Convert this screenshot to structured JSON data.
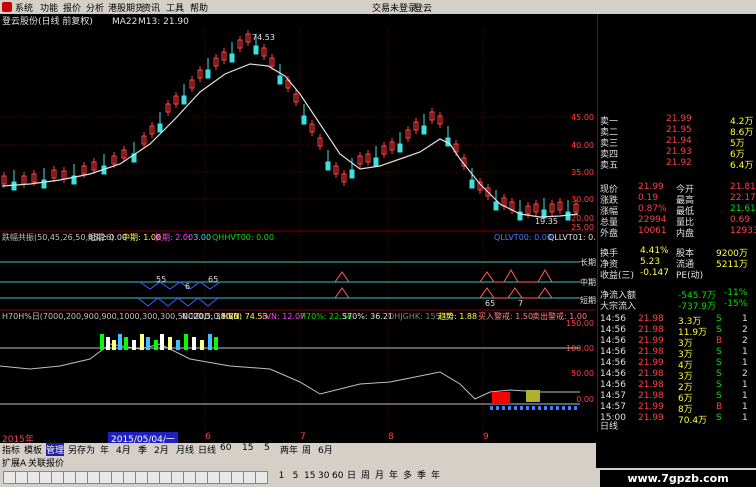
{
  "menu": {
    "items": [
      "系统",
      "功能",
      "报价",
      "分析",
      "港股期货",
      "资讯",
      "工具",
      "帮助"
    ],
    "right": [
      "交易未登录",
      "登云"
    ]
  },
  "chart_header": {
    "stock": "登云股份(日线 前复权)",
    "ma_label": "MA22",
    "m13": "M13: 21.90"
  },
  "price_axis": [
    "45.00",
    "40.00",
    "35.00",
    "30.00",
    "25.00",
    "20.00"
  ],
  "annotations": {
    "high": "74.53",
    "low": "19.35"
  },
  "indicator1": {
    "formula": "跌幅共振(50,45,26,50,45,26)",
    "short_label": "短期: 0.00",
    "mid_label": "中期: 1.00",
    "long_label": "长期: 2.00",
    "three": ": 3.00",
    "qhh": "QHHVT00: 0.00",
    "qll": "QLLVT00: 0.00",
    "qll2": "QLLVT01: 0.00",
    "lines": [
      "长期",
      "中期",
      "短期"
    ],
    "marks": [
      "55",
      "6",
      "65",
      "65",
      "7"
    ]
  },
  "indicator2": {
    "formula": "H70H%日(7000,200,900,900,1000,300,300,50000,5,0,50,0)",
    "ncz": "NCZ0D: 38.80",
    "hvn": "HVN: 74.53",
    "lvn": "LVN: 12.07",
    "h70": "H70%: 22.36",
    "s70": "S70%: 36.21",
    "ohj": "OHJGHK: 155.00",
    "trend": "趋势: 1.88",
    "buy": "买入警戒: 1.50",
    "sell": "卖出警戒: 1.00",
    "axis": [
      "150.00",
      "100.00",
      "50.00",
      "0.00"
    ]
  },
  "date_axis": {
    "year": "2015年",
    "cursor": "2015/05/04/一",
    "months": [
      "6",
      "7",
      "8",
      "9"
    ]
  },
  "tabs1": [
    "指标",
    "模板",
    "管理",
    "另存为",
    "年",
    "4月",
    "季",
    "2月",
    "月线",
    "日线",
    "60",
    "15",
    "5",
    "两年",
    "周",
    "6月"
  ],
  "tabs2": [
    "扩展A",
    "关联报价"
  ],
  "toolbar_periods": [
    "1",
    "5",
    "15",
    "30",
    "60",
    "日",
    "周",
    "月",
    "年",
    "多",
    "季",
    "年"
  ],
  "watermark": "www.7gpzb.com",
  "panel": {
    "sell": [
      {
        "label": "卖一",
        "price": "21.99",
        "vol": "4.2万"
      },
      {
        "label": "卖二",
        "price": "21.95",
        "vol": "8.6万"
      },
      {
        "label": "卖三",
        "price": "21.94",
        "vol": "5万"
      },
      {
        "label": "卖四",
        "price": "21.93",
        "vol": "6万"
      },
      {
        "label": "卖五",
        "price": "21.92",
        "vol": "6.4万"
      }
    ],
    "stats": [
      {
        "l1": "现价",
        "v1": "21.99",
        "l2": "今开",
        "v2": "21.81"
      },
      {
        "l1": "涨跌",
        "v1": "0.19",
        "l2": "最高",
        "v2": "22.17"
      },
      {
        "l1": "涨幅",
        "v1": "0.87%",
        "l2": "最低",
        "v2": "21.61"
      },
      {
        "l1": "总量",
        "v1": "22994",
        "l2": "量比",
        "v2": "0.69"
      },
      {
        "l1": "外盘",
        "v1": "10061",
        "l2": "内盘",
        "v2": "12933"
      }
    ],
    "fund": [
      {
        "l1": "换手",
        "v1": "4.41%",
        "l2": "股本",
        "v2": "9200万"
      },
      {
        "l1": "净资",
        "v1": "5.23",
        "l2": "流通",
        "v2": "5211万"
      },
      {
        "l1": "收益(三)",
        "v1": "-0.147",
        "l2": "PE(动)",
        "v2": ""
      }
    ],
    "flow": [
      {
        "l": "净流入额",
        "v": "-545.7万",
        "p": "-11%"
      },
      {
        "l": "大宗流入",
        "v": "-737.9万",
        "p": "-15%"
      }
    ],
    "ticks": [
      {
        "t": "14:56",
        "p": "21.98",
        "v": "3.3万",
        "f": "S",
        "n": "1"
      },
      {
        "t": "14:56",
        "p": "21.98",
        "v": "11.9万",
        "f": "S",
        "n": "2"
      },
      {
        "t": "14:56",
        "p": "21.99",
        "v": "3万",
        "f": "B",
        "n": "2"
      },
      {
        "t": "14:56",
        "p": "21.98",
        "v": "3万",
        "f": "S",
        "n": "1"
      },
      {
        "t": "14:56",
        "p": "21.99",
        "v": "4万",
        "f": "S",
        "n": "1"
      },
      {
        "t": "14:56",
        "p": "21.98",
        "v": "3万",
        "f": "S",
        "n": "2"
      },
      {
        "t": "14:56",
        "p": "21.98",
        "v": "2万",
        "f": "S",
        "n": "1"
      },
      {
        "t": "14:57",
        "p": "21.98",
        "v": "6万",
        "f": "S",
        "n": "1"
      },
      {
        "t": "14:57",
        "p": "21.99",
        "v": "8万",
        "f": "B",
        "n": "1"
      },
      {
        "t": "15:00",
        "p": "21.99",
        "v": "70.4万",
        "f": "S",
        "n": "1"
      }
    ],
    "tab_label": "日线"
  }
}
